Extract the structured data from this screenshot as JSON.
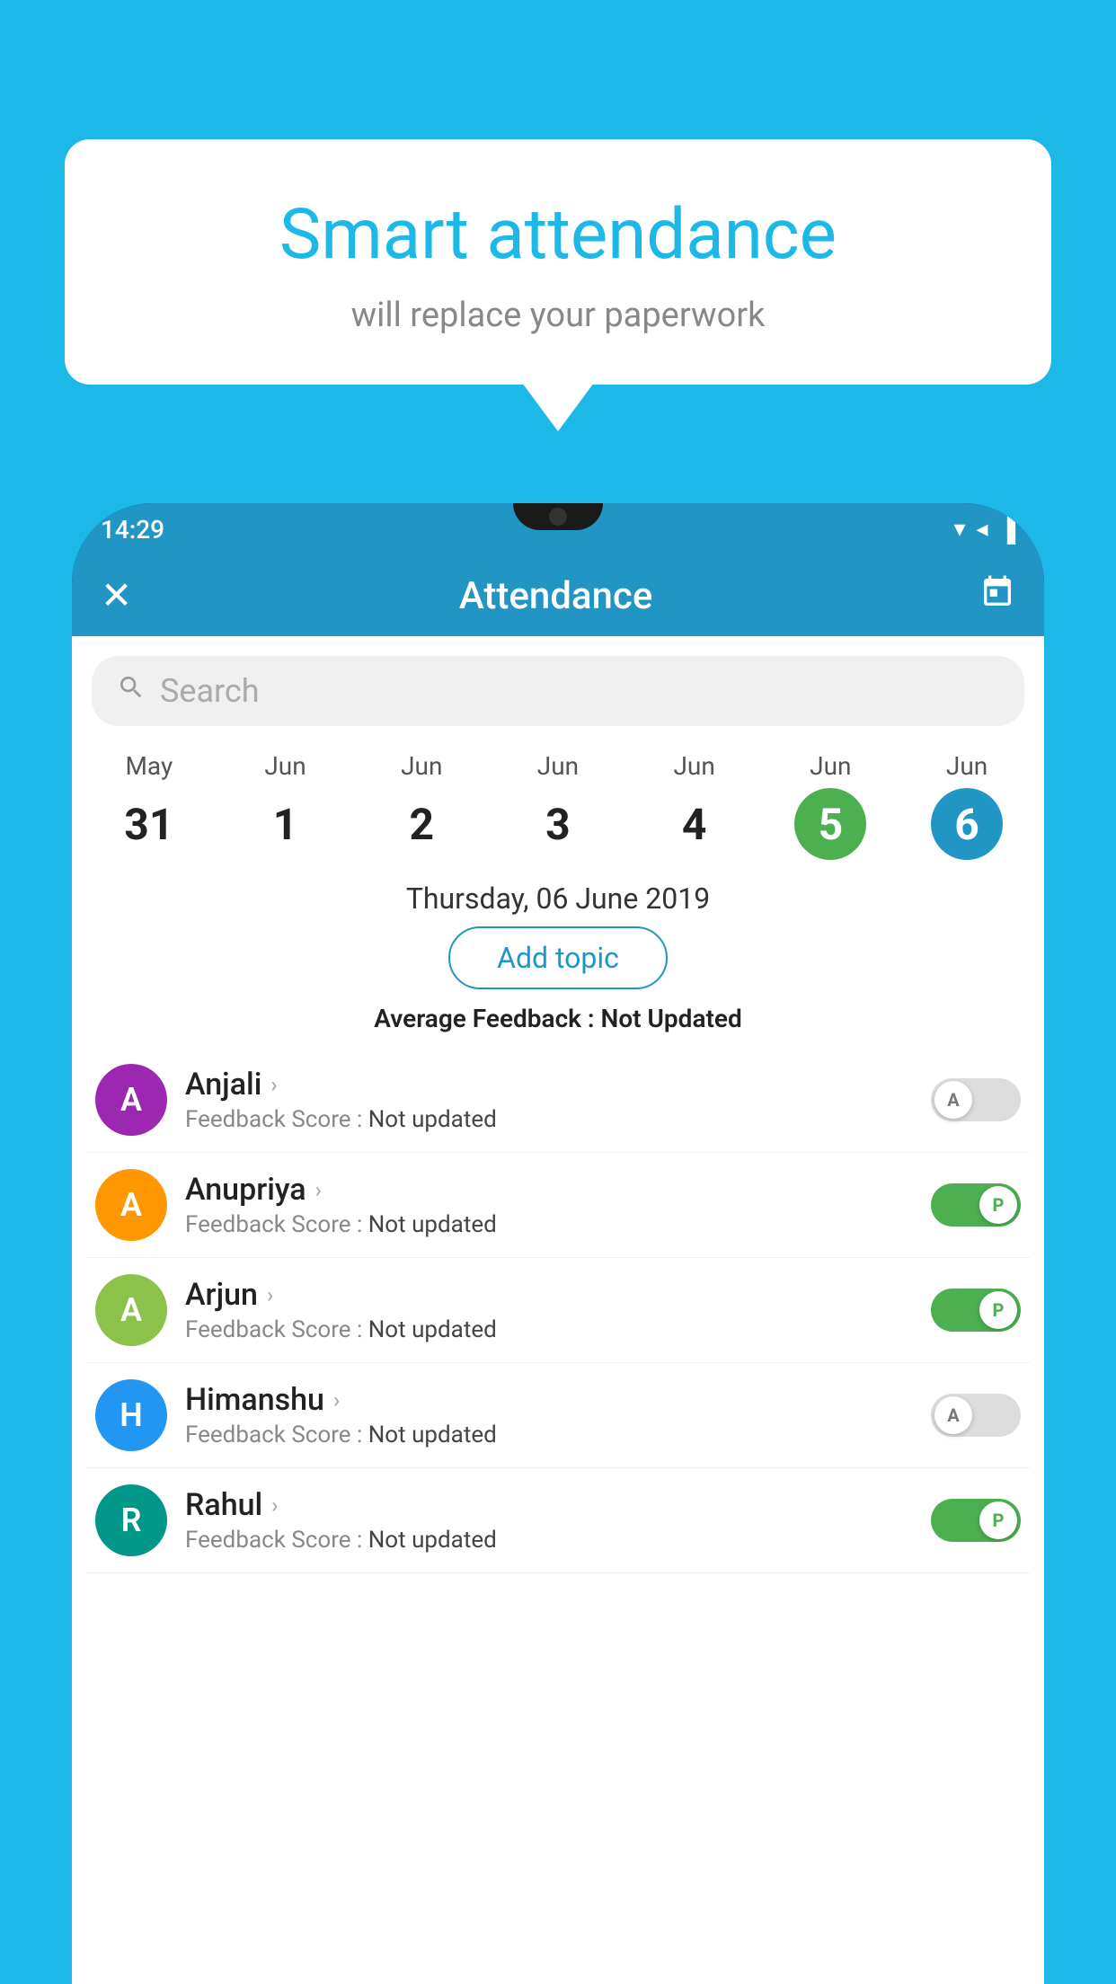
{
  "background": {
    "color": "#1BB8E8"
  },
  "speech_bubble": {
    "title": "Smart attendance",
    "subtitle": "will replace your paperwork"
  },
  "status_bar": {
    "time": "14:29",
    "wifi_icon": "▼",
    "signal_icon": "▲",
    "battery_icon": "▐"
  },
  "app_header": {
    "title": "Attendance",
    "close_label": "✕",
    "calendar_icon": "📅"
  },
  "search": {
    "placeholder": "Search"
  },
  "date_picker": {
    "dates": [
      {
        "month": "May",
        "day": "31",
        "selected": ""
      },
      {
        "month": "Jun",
        "day": "1",
        "selected": ""
      },
      {
        "month": "Jun",
        "day": "2",
        "selected": ""
      },
      {
        "month": "Jun",
        "day": "3",
        "selected": ""
      },
      {
        "month": "Jun",
        "day": "4",
        "selected": ""
      },
      {
        "month": "Jun",
        "day": "5",
        "selected": "green"
      },
      {
        "month": "Jun",
        "day": "6",
        "selected": "blue"
      }
    ]
  },
  "selected_date_label": "Thursday, 06 June 2019",
  "add_topic_label": "Add topic",
  "avg_feedback": {
    "prefix": "Average Feedback : ",
    "value": "Not Updated"
  },
  "students": [
    {
      "name": "Anjali",
      "initial": "A",
      "avatar_color": "av-purple",
      "feedback_label": "Feedback Score : ",
      "feedback_value": "Not updated",
      "toggle_state": "off",
      "toggle_letter": "A"
    },
    {
      "name": "Anupriya",
      "initial": "A",
      "avatar_color": "av-orange",
      "feedback_label": "Feedback Score : ",
      "feedback_value": "Not updated",
      "toggle_state": "on-green",
      "toggle_letter": "P"
    },
    {
      "name": "Arjun",
      "initial": "A",
      "avatar_color": "av-lightgreen",
      "feedback_label": "Feedback Score : ",
      "feedback_value": "Not updated",
      "toggle_state": "on-green",
      "toggle_letter": "P"
    },
    {
      "name": "Himanshu",
      "initial": "H",
      "avatar_color": "av-blue",
      "feedback_label": "Feedback Score : ",
      "feedback_value": "Not updated",
      "toggle_state": "off",
      "toggle_letter": "A"
    },
    {
      "name": "Rahul",
      "initial": "R",
      "avatar_color": "av-teal",
      "feedback_label": "Feedback Score : ",
      "feedback_value": "Not updated",
      "toggle_state": "on-green",
      "toggle_letter": "P"
    }
  ]
}
